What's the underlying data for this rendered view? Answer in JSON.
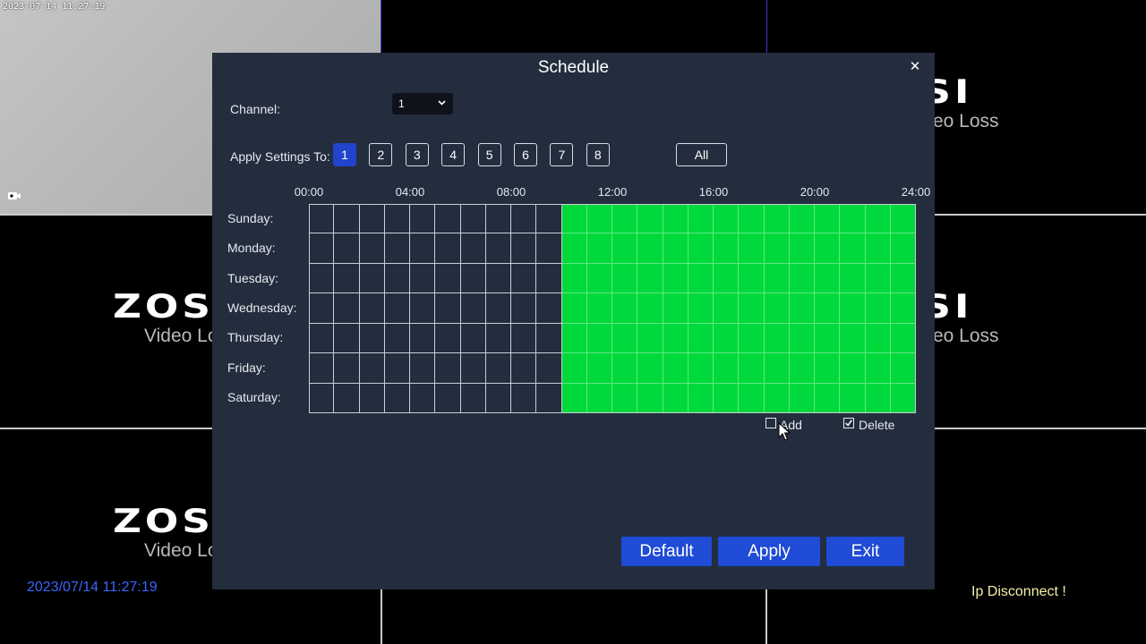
{
  "background": {
    "live_timestamp": "2023-07-14 11:27:19",
    "logo_text": "ZOSI",
    "video_loss_text": "Video Loss",
    "system_time": "2023/07/14 11:27:19",
    "ip_status": "Ip Disconnect !",
    "colors": {
      "system_time": "#3a66ff",
      "ip_status": "#f2f0a6"
    }
  },
  "dialog": {
    "title": "Schedule",
    "close_icon": "close-icon",
    "channel": {
      "label": "Channel:",
      "value": "1",
      "options_visible": [
        "1"
      ]
    },
    "apply_settings": {
      "label": "Apply Settings To:",
      "channels": [
        "1",
        "2",
        "3",
        "4",
        "5",
        "6",
        "7",
        "8"
      ],
      "selected": "1",
      "all_label": "All"
    },
    "time_labels": [
      "00:00",
      "04:00",
      "08:00",
      "12:00",
      "16:00",
      "20:00",
      "24:00"
    ],
    "days": [
      "Sunday:",
      "Monday:",
      "Tuesday:",
      "Wednesday:",
      "Thursday:",
      "Friday:",
      "Saturday:"
    ],
    "schedule": {
      "slots_per_day": 24,
      "active_from_hour": 10,
      "active_to_hour": 24,
      "active_color": "#00d93b"
    },
    "mode": {
      "add_label": "Add",
      "add_checked": false,
      "delete_label": "Delete",
      "delete_checked": true
    },
    "buttons": {
      "default": "Default",
      "apply": "Apply",
      "exit": "Exit"
    },
    "colors": {
      "panel": "#232d3d",
      "button": "#1f4bd6",
      "selected_channel": "#2244cc"
    }
  }
}
